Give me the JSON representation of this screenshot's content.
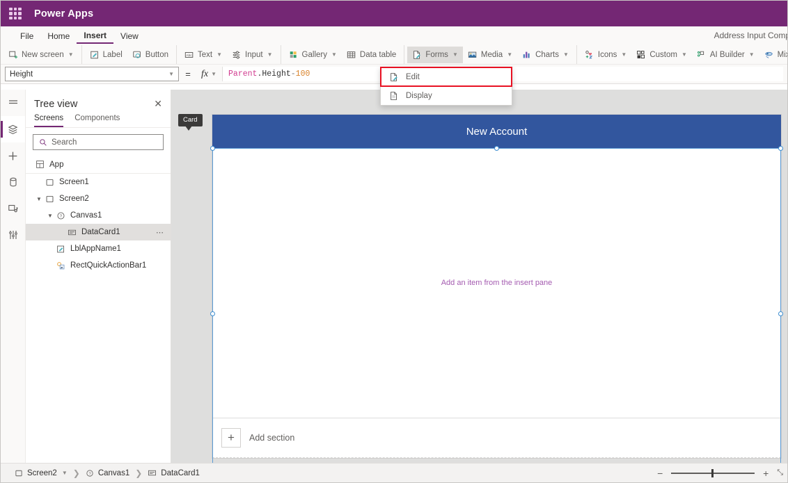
{
  "topbar": {
    "brand": "Power Apps",
    "waffle_icon": "waffle-icon"
  },
  "ribbon": {
    "tabs": [
      {
        "label": "File",
        "active": false
      },
      {
        "label": "Home",
        "active": false
      },
      {
        "label": "Insert",
        "active": true
      },
      {
        "label": "View",
        "active": false
      }
    ],
    "app_name": "Address Input Comp"
  },
  "toolbar": {
    "groups": [
      {
        "items": [
          {
            "label": "New screen",
            "icon": "new-screen-icon",
            "caret": true
          }
        ]
      },
      {
        "items": [
          {
            "label": "Label",
            "icon": "label-icon",
            "caret": false
          },
          {
            "label": "Button",
            "icon": "button-icon",
            "caret": false
          }
        ]
      },
      {
        "items": [
          {
            "label": "Text",
            "icon": "text-icon",
            "caret": true
          },
          {
            "label": "Input",
            "icon": "input-icon",
            "caret": true
          }
        ]
      },
      {
        "items": [
          {
            "label": "Gallery",
            "icon": "gallery-icon",
            "caret": true
          },
          {
            "label": "Data table",
            "icon": "data-table-icon",
            "caret": false
          }
        ]
      },
      {
        "items": [
          {
            "label": "Forms",
            "icon": "forms-icon",
            "caret": true,
            "open": true
          },
          {
            "label": "Media",
            "icon": "media-icon",
            "caret": true
          },
          {
            "label": "Charts",
            "icon": "charts-icon",
            "caret": true
          }
        ]
      },
      {
        "items": [
          {
            "label": "Icons",
            "icon": "icons-icon",
            "caret": true
          },
          {
            "label": "Custom",
            "icon": "custom-icon",
            "caret": true
          },
          {
            "label": "AI Builder",
            "icon": "ai-builder-icon",
            "caret": true
          },
          {
            "label": "Mixed Reality",
            "icon": "mixed-reality-icon",
            "caret": true
          }
        ]
      }
    ]
  },
  "forms_menu": {
    "items": [
      {
        "label": "Edit",
        "icon": "edit-form-icon",
        "highlighted": true
      },
      {
        "label": "Display",
        "icon": "display-form-icon",
        "highlighted": false
      }
    ]
  },
  "formula": {
    "property": "Height",
    "equals": "=",
    "fx": "fx",
    "tokens": [
      {
        "text": "Parent",
        "cls": "f-parent"
      },
      {
        "text": ".Height",
        "cls": "f-prop"
      },
      {
        "text": " - ",
        "cls": "f-op"
      },
      {
        "text": "100",
        "cls": "f-num"
      }
    ]
  },
  "rail": {
    "items": [
      {
        "name": "hamburger-icon",
        "selected": false
      },
      {
        "name": "tree-view-icon",
        "selected": true
      },
      {
        "name": "insert-icon",
        "selected": false
      },
      {
        "name": "data-icon",
        "selected": false
      },
      {
        "name": "media-library-icon",
        "selected": false
      },
      {
        "name": "advanced-tools-icon",
        "selected": false
      }
    ]
  },
  "tree": {
    "title": "Tree view",
    "close_icon": "close-icon",
    "tabs": [
      {
        "label": "Screens",
        "active": true
      },
      {
        "label": "Components",
        "active": false
      }
    ],
    "search": {
      "placeholder": "Search",
      "value": "",
      "icon": "search-icon"
    },
    "nodes": [
      {
        "label": "App",
        "icon": "app-icon",
        "indent": 0,
        "twisty": "",
        "selected": false,
        "more": false,
        "divider": true
      },
      {
        "label": "Screen1",
        "icon": "screen-icon",
        "indent": 0,
        "twisty": "",
        "selected": false,
        "more": false
      },
      {
        "label": "Screen2",
        "icon": "screen-icon",
        "indent": 0,
        "twisty": "v",
        "selected": false,
        "more": false
      },
      {
        "label": "Canvas1",
        "icon": "canvas-icon",
        "indent": 1,
        "twisty": "v",
        "selected": false,
        "more": false
      },
      {
        "label": "DataCard1",
        "icon": "datacard-icon",
        "indent": 2,
        "twisty": "",
        "selected": true,
        "more": true
      },
      {
        "label": "LblAppName1",
        "icon": "label-icon",
        "indent": 1,
        "twisty": "",
        "selected": false,
        "more": false
      },
      {
        "label": "RectQuickActionBar1",
        "icon": "rectangle-icon",
        "indent": 1,
        "twisty": "",
        "selected": false,
        "more": false
      }
    ]
  },
  "canvas": {
    "card_tag": "Card",
    "form_title": "New Account",
    "empty_text": "Add an item from the insert pane",
    "add_section": "Add section",
    "plus_icon": "plus-icon",
    "header_color": "#32569E",
    "selection_color": "#3e8ed0"
  },
  "status": {
    "breadcrumbs": [
      {
        "label": "Screen2",
        "icon": "screen-icon",
        "caret": true
      },
      {
        "label": "Canvas1",
        "icon": "canvas-icon",
        "caret": false
      },
      {
        "label": "DataCard1",
        "icon": "datacard-icon",
        "caret": false
      }
    ],
    "zoom_out": "−",
    "zoom_in": "+",
    "fit_label": "⤡"
  }
}
